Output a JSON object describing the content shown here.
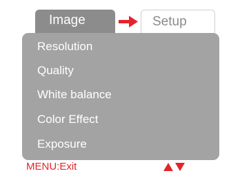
{
  "tabs": {
    "image_label": "Image",
    "setup_label": "Setup"
  },
  "menu": {
    "items": [
      {
        "label": "Resolution"
      },
      {
        "label": "Quality"
      },
      {
        "label": "White balance"
      },
      {
        "label": "Color Effect"
      },
      {
        "label": "Exposure"
      }
    ]
  },
  "footer": {
    "exit_label": "MENU:Exit"
  },
  "icons": {
    "tab_arrow": "arrow-right-icon",
    "nav": "up-down-arrows-icon"
  },
  "colors": {
    "accent_red": "#e3242b",
    "panel_gray": "#a3a3a3",
    "tab_gray": "#8c8c8c"
  }
}
